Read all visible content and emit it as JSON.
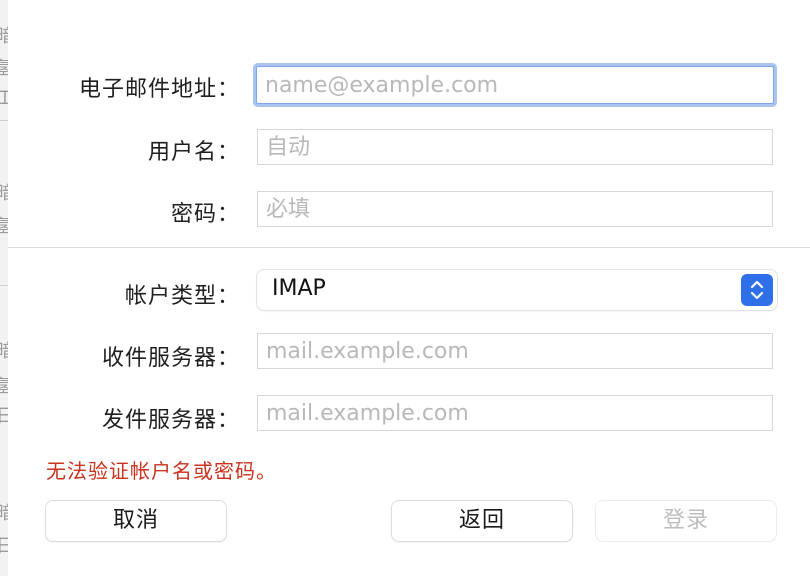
{
  "background_fragments": [
    "暗",
    "氢",
    "工",
    "暗",
    "氢",
    "暗",
    "氢",
    "日",
    "暗",
    "日"
  ],
  "labels": {
    "email": "电子邮件地址：",
    "username": "用户名：",
    "password": "密码：",
    "account_type": "帐户类型：",
    "incoming_server": "收件服务器：",
    "outgoing_server": "发件服务器："
  },
  "fields": {
    "email": {
      "value": "",
      "placeholder": "name@example.com"
    },
    "username": {
      "value": "",
      "placeholder": "自动"
    },
    "password": {
      "value": "",
      "placeholder": "必填"
    },
    "incoming_server": {
      "value": "",
      "placeholder": "mail.example.com"
    },
    "outgoing_server": {
      "value": "",
      "placeholder": "mail.example.com"
    }
  },
  "account_type": {
    "selected": "IMAP"
  },
  "error_message": "无法验证帐户名或密码。",
  "buttons": {
    "cancel": "取消",
    "back": "返回",
    "sign_in": "登录"
  },
  "colors": {
    "accent": "#2f6fe8",
    "focus_ring": "#a9c4f0",
    "error": "#c8321e",
    "disabled_text": "#bdbdbd"
  },
  "icons": {
    "account_type_stepper": "chevron-up-down-icon"
  }
}
